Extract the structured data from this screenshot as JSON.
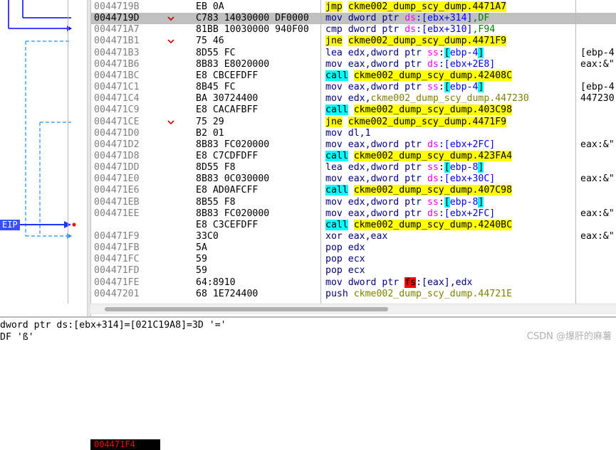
{
  "rows": [
    {
      "addr": "0044719B",
      "bytes": "EB 0A",
      "mn": "jmp",
      "ops": [
        {
          "t": "ckme002_dump_scy_dump.4471A7",
          "c": "hl"
        }
      ],
      "cmt": ""
    },
    {
      "addr": "0044719D",
      "bytes": "C783 14030000 DF0000",
      "mn": "mov",
      "ops": [
        {
          "t": "dword ptr ",
          "c": "kw"
        },
        {
          "t": "ds",
          "c": "sq"
        },
        {
          "t": ":[ebx+314]",
          "c": "pp"
        },
        {
          "t": ",DF",
          "c": "nm"
        }
      ],
      "cmt": ""
    },
    {
      "addr": "004471A7",
      "bytes": "81BB 10030000 940F00",
      "mn": "cmp",
      "ops": [
        {
          "t": "dword ptr ",
          "c": "kw"
        },
        {
          "t": "ds",
          "c": "sq"
        },
        {
          "t": ":[ebx+310]",
          "c": "pp"
        },
        {
          "t": ",F94",
          "c": "nm"
        }
      ],
      "cmt": ""
    },
    {
      "addr": "004471B1",
      "bytes": "75 46",
      "mn": "jne",
      "ops": [
        {
          "t": "ckme002_dump_scy_dump.4471F9",
          "c": "hl"
        }
      ],
      "cmt": ""
    },
    {
      "addr": "004471B3",
      "bytes": "8D55 FC",
      "mn": "lea",
      "ops": [
        {
          "t": "edx,dword ptr ",
          "c": "kw"
        },
        {
          "t": "ss",
          "c": "sq"
        },
        {
          "t": ":",
          "c": ""
        },
        {
          "t": "[",
          "c": "cy"
        },
        {
          "t": "ebp-4",
          "c": "pp"
        },
        {
          "t": "]",
          "c": "cy"
        }
      ],
      "cmt": "[ebp-4"
    },
    {
      "addr": "004471B6",
      "bytes": "8B83 E8020000",
      "mn": "mov",
      "ops": [
        {
          "t": "eax,dword ptr ",
          "c": "kw"
        },
        {
          "t": "ds",
          "c": "sq"
        },
        {
          "t": ":[ebx+2E8]",
          "c": "pp"
        }
      ],
      "cmt": "eax:&\""
    },
    {
      "addr": "004471BC",
      "bytes": "E8 CBCEFDFF",
      "mn": "call",
      "ops": [
        {
          "t": "ckme002_dump_scy_dump.42408C",
          "c": "hl"
        }
      ],
      "cmt": ""
    },
    {
      "addr": "004471C1",
      "bytes": "8B45 FC",
      "mn": "mov",
      "ops": [
        {
          "t": "eax,dword ptr ",
          "c": "kw"
        },
        {
          "t": "ss",
          "c": "sq"
        },
        {
          "t": ":",
          "c": ""
        },
        {
          "t": "[",
          "c": "cy"
        },
        {
          "t": "ebp-4",
          "c": "pp"
        },
        {
          "t": "]",
          "c": "cy"
        }
      ],
      "cmt": "[ebp-4"
    },
    {
      "addr": "004471C4",
      "bytes": "BA 30724400",
      "mn": "mov",
      "ops": [
        {
          "t": "edx,",
          "c": "kw"
        },
        {
          "t": "ckme002_dump_scy_dump.447230",
          "c": "tg"
        }
      ],
      "cmt": "447230"
    },
    {
      "addr": "004471C9",
      "bytes": "E8 CACAFBFF",
      "mn": "call",
      "ops": [
        {
          "t": "ckme002_dump_scy_dump.403C98",
          "c": "hl"
        }
      ],
      "cmt": ""
    },
    {
      "addr": "004471CE",
      "bytes": "75 29",
      "mn": "jne",
      "ops": [
        {
          "t": "ckme002_dump_scy_dump.4471F9",
          "c": "hl"
        }
      ],
      "cmt": ""
    },
    {
      "addr": "004471D0",
      "bytes": "B2 01",
      "mn": "mov",
      "ops": [
        {
          "t": "dl,1",
          "c": "kw"
        }
      ],
      "cmt": ""
    },
    {
      "addr": "004471D2",
      "bytes": "8B83 FC020000",
      "mn": "mov",
      "ops": [
        {
          "t": "eax,dword ptr ",
          "c": "kw"
        },
        {
          "t": "ds",
          "c": "sq"
        },
        {
          "t": ":[ebx+2FC]",
          "c": "pp"
        }
      ],
      "cmt": "eax:&\""
    },
    {
      "addr": "004471D8",
      "bytes": "E8 C7CDFDFF",
      "mn": "call",
      "ops": [
        {
          "t": "ckme002_dump_scy_dump.423FA4",
          "c": "hl"
        }
      ],
      "cmt": ""
    },
    {
      "addr": "004471DD",
      "bytes": "8D55 F8",
      "mn": "lea",
      "ops": [
        {
          "t": "edx,dword ptr ",
          "c": "kw"
        },
        {
          "t": "ss",
          "c": "sq"
        },
        {
          "t": ":",
          "c": ""
        },
        {
          "t": "[",
          "c": "cy"
        },
        {
          "t": "ebp-8",
          "c": "pp"
        },
        {
          "t": "]",
          "c": "cy"
        }
      ],
      "cmt": ""
    },
    {
      "addr": "004471E0",
      "bytes": "8B83 0C030000",
      "mn": "mov",
      "ops": [
        {
          "t": "eax,dword ptr ",
          "c": "kw"
        },
        {
          "t": "ds",
          "c": "sq"
        },
        {
          "t": ":[ebx+30C]",
          "c": "pp"
        }
      ],
      "cmt": "eax:&\""
    },
    {
      "addr": "004471E6",
      "bytes": "E8 AD0AFCFF",
      "mn": "call",
      "ops": [
        {
          "t": "ckme002_dump_scy_dump.407C98",
          "c": "hl"
        }
      ],
      "cmt": ""
    },
    {
      "addr": "004471EB",
      "bytes": "8B55 F8",
      "mn": "mov",
      "ops": [
        {
          "t": "edx,dword ptr ",
          "c": "kw"
        },
        {
          "t": "ss",
          "c": "sq"
        },
        {
          "t": ":",
          "c": ""
        },
        {
          "t": "[",
          "c": "cy"
        },
        {
          "t": "ebp-8",
          "c": "pp"
        },
        {
          "t": "]",
          "c": "cy"
        }
      ],
      "cmt": ""
    },
    {
      "addr": "004471EE",
      "bytes": "8B83 FC020000",
      "mn": "mov",
      "ops": [
        {
          "t": "eax,dword ptr ",
          "c": "kw"
        },
        {
          "t": "ds",
          "c": "sq"
        },
        {
          "t": ":[ebx+2FC]",
          "c": "pp"
        }
      ],
      "cmt": "eax:&\""
    },
    {
      "addr": "004471F4",
      "bytes": "E8 C3CEFDFF",
      "mn": "call",
      "ops": [
        {
          "t": "ckme002_dump_scy_dump.4240BC",
          "c": "hl"
        }
      ],
      "cmt": ""
    },
    {
      "addr": "004471F9",
      "bytes": "33C0",
      "mn": "xor",
      "ops": [
        {
          "t": "eax,eax",
          "c": "kw"
        }
      ],
      "cmt": "eax:&\""
    },
    {
      "addr": "004471FB",
      "bytes": "5A",
      "mn": "pop",
      "ops": [
        {
          "t": "edx",
          "c": "kw"
        }
      ],
      "cmt": ""
    },
    {
      "addr": "004471FC",
      "bytes": "59",
      "mn": "pop",
      "ops": [
        {
          "t": "ecx",
          "c": "kw"
        }
      ],
      "cmt": ""
    },
    {
      "addr": "004471FD",
      "bytes": "59",
      "mn": "pop",
      "ops": [
        {
          "t": "ecx",
          "c": "kw"
        }
      ],
      "cmt": ""
    },
    {
      "addr": "004471FE",
      "bytes": "64:8910",
      "mn": "mov",
      "ops": [
        {
          "t": "dword ptr ",
          "c": "kw"
        },
        {
          "t": "fs",
          "c": "fsbox"
        },
        {
          "t": ":[eax],edx",
          "c": "kw"
        }
      ],
      "cmt": ""
    },
    {
      "addr": "00447201",
      "bytes": "68 1E724400",
      "mn": "push",
      "ops": [
        {
          "t": "ckme002_dump_scy_dump.44721E",
          "c": "tg"
        }
      ],
      "cmt": ""
    }
  ],
  "selected_index": 1,
  "eip_index": 19,
  "eip_label": "EIP",
  "status": {
    "line1": "dword ptr ds:[ebx+314]=[021C19A8]=3D '='",
    "line2": "DF 'ß'"
  },
  "watermark": "CSDN @爆肝的麻薯"
}
